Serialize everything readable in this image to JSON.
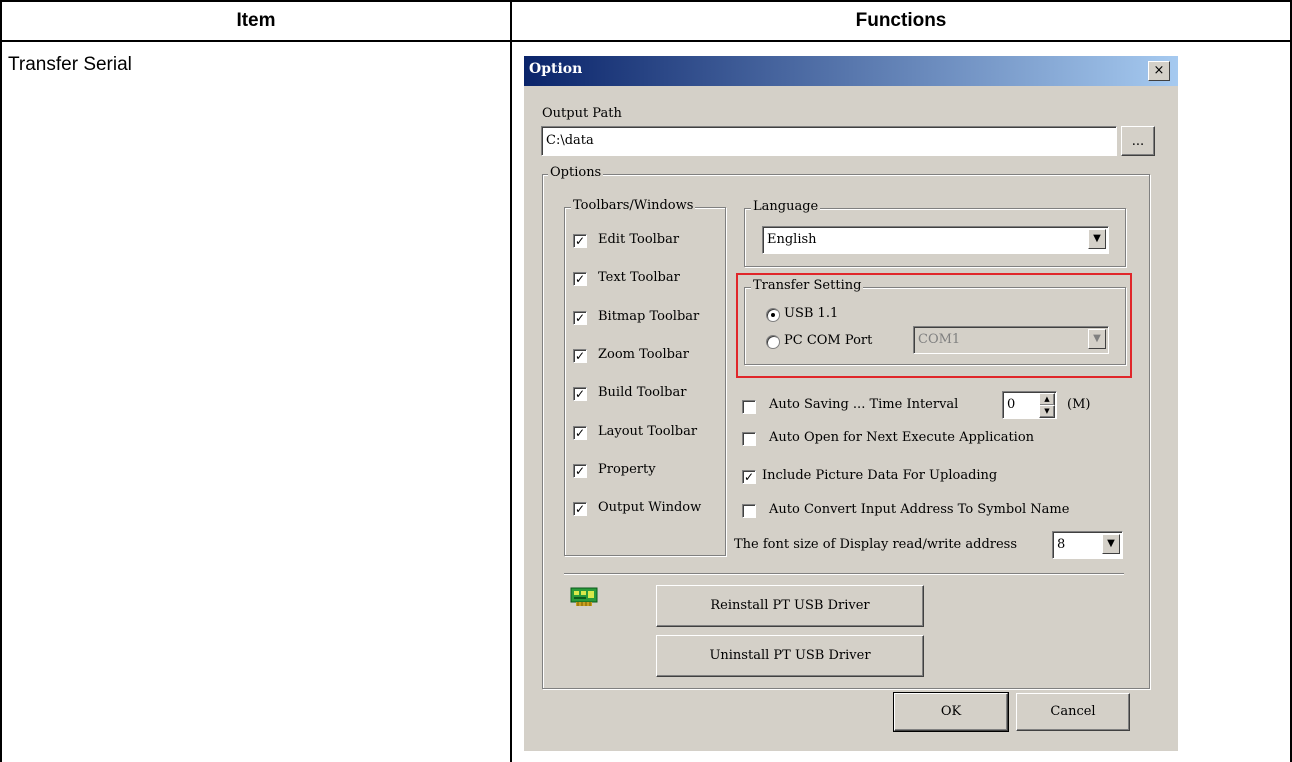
{
  "table": {
    "headers": [
      "Item",
      "Functions"
    ],
    "item": "Transfer Serial"
  },
  "dialog": {
    "title": "Option",
    "close_icon": "×",
    "output_path": {
      "label": "Output Path",
      "value": "C:\\data",
      "browse_label": "..."
    },
    "options_group": "Options",
    "toolbars": {
      "title": "Toolbars/Windows",
      "items": [
        {
          "label": "Edit Toolbar",
          "checked": true
        },
        {
          "label": "Text Toolbar",
          "checked": true
        },
        {
          "label": "Bitmap Toolbar",
          "checked": true
        },
        {
          "label": "Zoom Toolbar",
          "checked": true
        },
        {
          "label": "Build Toolbar",
          "checked": true
        },
        {
          "label": "Layout Toolbar",
          "checked": true
        },
        {
          "label": "Property",
          "checked": true
        },
        {
          "label": "Output Window",
          "checked": true
        }
      ]
    },
    "language": {
      "title": "Language",
      "value": "English"
    },
    "transfer": {
      "title": "Transfer Setting",
      "usb_label": "USB 1.1",
      "com_label": "PC COM Port",
      "com_value": "COM1",
      "selected": "usb"
    },
    "auto_saving": {
      "label": "Auto Saving ... Time Interval",
      "value": "0",
      "unit": "(M)",
      "checked": false
    },
    "auto_open": {
      "label": "Auto Open for Next Execute Application",
      "checked": false
    },
    "include_picture": {
      "label": "Include Picture Data For Uploading",
      "checked": true
    },
    "auto_convert": {
      "label": "Auto Convert Input Address To Symbol Name",
      "checked": false
    },
    "font_size": {
      "label": "The font size of Display read/write address",
      "value": "8"
    },
    "reinstall_label": "Reinstall PT USB Driver",
    "uninstall_label": "Uninstall PT USB Driver",
    "ok_label": "OK",
    "cancel_label": "Cancel",
    "check_mark": "✓",
    "arrow_down": "▼",
    "colors": {
      "title_start": "#0a246a",
      "title_end": "#a6caf0",
      "highlight": "#e0262a",
      "face": "#d4d0c8"
    }
  }
}
